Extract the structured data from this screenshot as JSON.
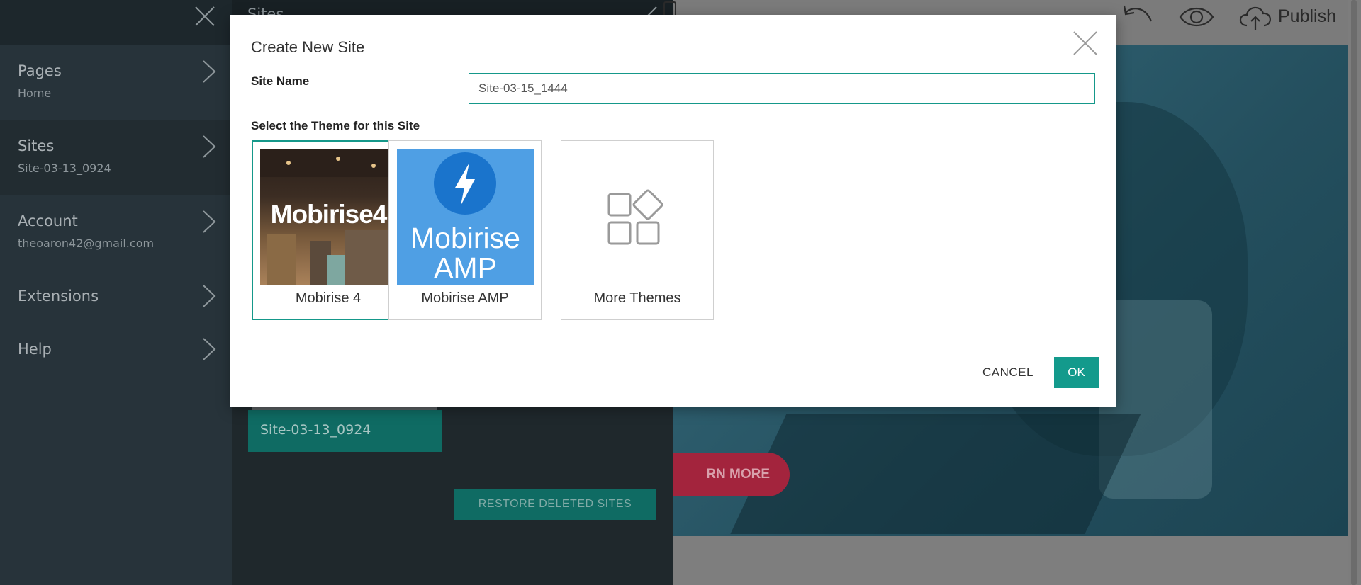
{
  "sidebar": {
    "items": [
      {
        "title": "Pages",
        "subtitle": "Home"
      },
      {
        "title": "Sites",
        "subtitle": "Site-03-13_0924"
      },
      {
        "title": "Account",
        "subtitle": "theoaron42@gmail.com"
      },
      {
        "title": "Extensions",
        "subtitle": ""
      },
      {
        "title": "Help",
        "subtitle": ""
      }
    ]
  },
  "sites_panel": {
    "title": "Sites",
    "current_site": "Site-03-13_0924",
    "restore_label": "RESTORE DELETED SITES"
  },
  "editor": {
    "learn_more_label": "RN MORE",
    "publish_label": "Publish"
  },
  "modal": {
    "title": "Create New Site",
    "site_name_label": "Site Name",
    "site_name_value": "Site-03-15_1444",
    "theme_label": "Select the Theme for this Site",
    "themes": [
      {
        "name": "Mobirise 4",
        "thumb_text": "Mobirise4",
        "selected": true
      },
      {
        "name": "Mobirise AMP",
        "thumb_text_line1": "Mobirise",
        "thumb_text_line2": "AMP",
        "selected": false
      },
      {
        "name": "More Themes",
        "selected": false
      }
    ],
    "cancel_label": "CANCEL",
    "ok_label": "OK"
  },
  "colors": {
    "accent": "#139a8c",
    "sidebar_bg": "#27333a",
    "amp_blue": "#4f9fe4",
    "learn_more": "#a3243d"
  },
  "icons": {
    "sidebar_close": "close-icon",
    "chevron": "chevron-right-icon",
    "pencil": "pencil-icon",
    "undo": "undo-icon",
    "preview": "eye-icon",
    "publish": "cloud-upload-icon",
    "modal_close": "close-icon",
    "amp_bolt": "lightning-icon",
    "more_themes": "blocks-icon"
  }
}
